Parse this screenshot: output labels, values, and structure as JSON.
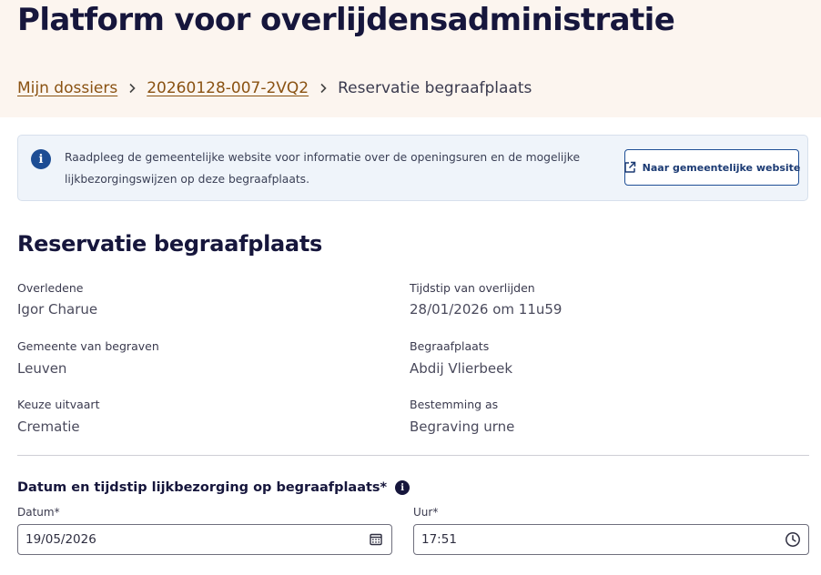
{
  "header": {
    "title": "Platform voor overlijdensadministratie",
    "breadcrumb": {
      "items": [
        "Mijn dossiers",
        "20260128-007-2VQ2"
      ],
      "current": "Reservatie begraafplaats"
    }
  },
  "info": {
    "text": "Raadpleeg de gemeentelijke website voor informatie over de openingsuren en de mogelijke lijkbezorgingswijzen op deze begraafplaats.",
    "button_label": "Naar gemeentelijke website"
  },
  "section": {
    "title": "Reservatie begraafplaats",
    "fields": [
      {
        "label": "Overledene",
        "value": "Igor Charue"
      },
      {
        "label": "Tijdstip van overlijden",
        "value": "28/01/2026 om 11u59"
      },
      {
        "label": "Gemeente van begraven",
        "value": "Leuven"
      },
      {
        "label": "Begraafplaats",
        "value": "Abdij Vlierbeek"
      },
      {
        "label": "Keuze uitvaart",
        "value": "Crematie"
      },
      {
        "label": "Bestemming as",
        "value": "Begraving urne"
      }
    ]
  },
  "datetime": {
    "heading": "Datum en tijdstip lijkbezorging op begraafplaats*",
    "date_label": "Datum*",
    "date_value": "19/05/2026",
    "time_label": "Uur*",
    "time_value": "17:51"
  },
  "colors": {
    "header_bg": "#fcf5ef",
    "link": "#8a5212",
    "info_bg": "#eff4fa",
    "info_accent": "#1d4d94",
    "title": "#16163c"
  },
  "icons": [
    "chevron-right-icon",
    "info-icon",
    "external-link-icon",
    "help-icon",
    "calendar-icon",
    "clock-icon"
  ]
}
